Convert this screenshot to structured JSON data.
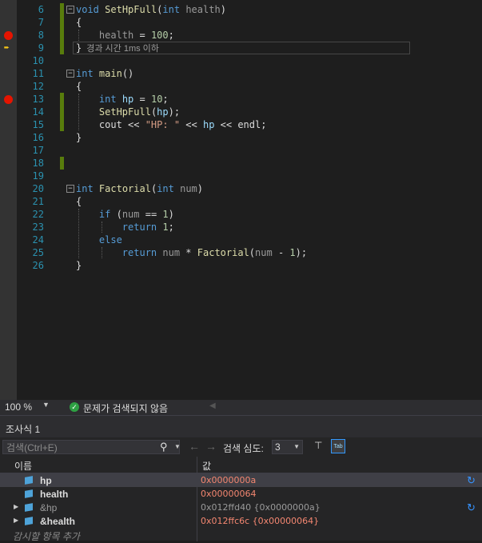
{
  "editor": {
    "lines": [
      {
        "num": "6"
      },
      {
        "num": "7"
      },
      {
        "num": "8"
      },
      {
        "num": "9"
      },
      {
        "num": "10"
      },
      {
        "num": "11"
      },
      {
        "num": "12"
      },
      {
        "num": "13"
      },
      {
        "num": "14"
      },
      {
        "num": "15"
      },
      {
        "num": "16"
      },
      {
        "num": "17"
      },
      {
        "num": "18"
      },
      {
        "num": "19"
      },
      {
        "num": "20"
      },
      {
        "num": "21"
      },
      {
        "num": "22"
      },
      {
        "num": "23"
      },
      {
        "num": "24"
      },
      {
        "num": "25"
      },
      {
        "num": "26"
      }
    ],
    "code": {
      "l6_kw": "void",
      "l6_fn": "SetHpFull",
      "l6_p1": "(",
      "l6_kw2": "int",
      "l6_par": "health",
      "l6_p2": ")",
      "l7": "{",
      "l8_var": "health",
      "l8_op": " = ",
      "l8_num": "100",
      "l8_end": ";",
      "l9": "}",
      "l9_hint": "경과 시간 1ms 이하",
      "l11_kw": "int",
      "l11_fn": "main",
      "l11_p": "()",
      "l12": "{",
      "l13_kw": "int",
      "l13_var": "hp",
      "l13_op": " = ",
      "l13_num": "10",
      "l13_end": ";",
      "l14_fn": "SetHpFull",
      "l14_p1": "(",
      "l14_var": "hp",
      "l14_p2": ");",
      "l15_a": "cout << ",
      "l15_str": "\"HP: \"",
      "l15_b": " << ",
      "l15_var": "hp",
      "l15_c": " << endl;",
      "l16": "}",
      "l20_kw": "int",
      "l20_fn": "Factorial",
      "l20_p1": "(",
      "l20_kw2": "int",
      "l20_par": "num",
      "l20_p2": ")",
      "l21": "{",
      "l22_kw": "if",
      "l22_a": " (",
      "l22_par": "num",
      "l22_b": " == ",
      "l22_num": "1",
      "l22_c": ")",
      "l23_kw": "return",
      "l23_num": "1",
      "l23_end": ";",
      "l24_kw": "else",
      "l25_kw": "return",
      "l25_par": "num",
      "l25_a": " * ",
      "l25_fn": "Factorial",
      "l25_b": "(",
      "l25_par2": "num",
      "l25_c": " - ",
      "l25_num": "1",
      "l25_d": ");",
      "l26": "}"
    }
  },
  "status": {
    "zoom": "100 %",
    "issues": "문제가 검색되지 않음"
  },
  "watch": {
    "title": "조사식 1",
    "search_placeholder": "검색(Ctrl+E)",
    "depth_label": "검색 심도:",
    "depth_value": "3",
    "col_name": "이름",
    "col_value": "값",
    "rows": [
      {
        "name": "hp",
        "value": "0x0000000a"
      },
      {
        "name": "health",
        "value": "0x00000064"
      },
      {
        "name": "&hp",
        "value": "0x012ffd40 {0x0000000a}"
      },
      {
        "name": "&health",
        "value": "0x012ffc6c {0x00000064}"
      }
    ],
    "add_item": "감시할 항목 추가"
  },
  "colors": {
    "keyword": "#569cd6",
    "function": "#dcdcaa",
    "number": "#b5cea8",
    "string": "#d69d85",
    "changed_value": "#f48771",
    "breakpoint": "#e51400",
    "change_marker": "#587c0c"
  },
  "icons": {
    "breakpoint": "breakpoint-icon",
    "current_statement": "current-statement-arrow-icon",
    "no_issues": "check-circle-icon",
    "search": "search-icon",
    "refresh": "refresh-icon",
    "expand": "expand-arrow-icon",
    "variable": "variable-cube-icon"
  }
}
